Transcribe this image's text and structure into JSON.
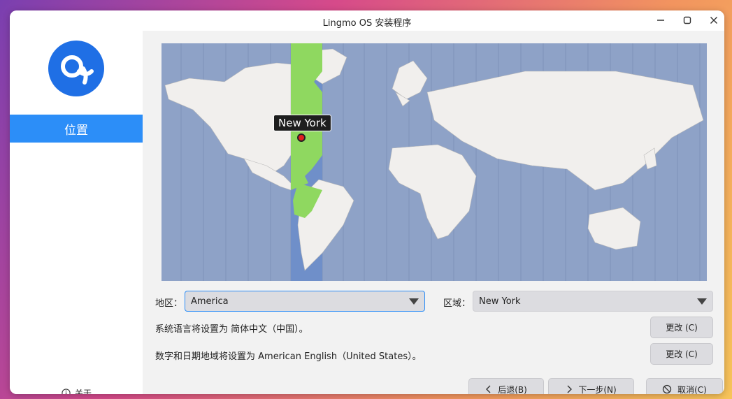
{
  "window": {
    "title": "Lingmo OS 安装程序"
  },
  "sidebar": {
    "logo_icon": "lingmo-logo",
    "items": [
      {
        "label": "位置",
        "active": true
      }
    ],
    "about_label": "关于",
    "accent_color": "#2c8ef8"
  },
  "map": {
    "selected_city": "New York",
    "timezone_highlight_color": "#8fd860"
  },
  "location": {
    "region_label": "地区：",
    "region_value": "America",
    "zone_label": "区域：",
    "zone_value": "New York"
  },
  "language": {
    "system_text": "系统语言将设置为 简体中文（中国）。",
    "system_change": "更改 (C)",
    "format_text": "数字和日期地域将设置为 American English（United States）。",
    "format_change": "更改 (C)"
  },
  "footer": {
    "back_label": "后退(B)",
    "next_label": "下一步(N)",
    "cancel_label": "取消(C)"
  }
}
